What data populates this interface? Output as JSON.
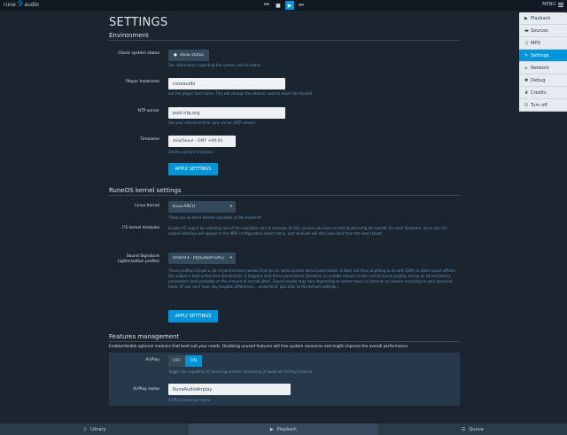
{
  "topbar": {
    "logo": {
      "word1": "rune",
      "word2": "audio",
      "mark": "9"
    },
    "menu_label": "MENU"
  },
  "menu": {
    "items": [
      {
        "label": "Playback",
        "icon": "play-icon"
      },
      {
        "label": "Sources",
        "icon": "folder-icon"
      },
      {
        "label": "MPD",
        "icon": "mpd-icon"
      },
      {
        "label": "Settings",
        "icon": "wrench-icon"
      },
      {
        "label": "Network",
        "icon": "network-icon"
      },
      {
        "label": "Debug",
        "icon": "bug-icon"
      },
      {
        "label": "Credits",
        "icon": "trophy-icon"
      },
      {
        "label": "Turn off",
        "icon": "power-icon"
      }
    ]
  },
  "page": {
    "title": "SETTINGS"
  },
  "environment": {
    "legend": "Environment",
    "check_status": {
      "label": "Check system status",
      "button": "show status",
      "help": "See information regarding the system and its status."
    },
    "hostname": {
      "label": "Player hostname",
      "value": "runeaudio",
      "help": "Set the player host name. This will change the address used to reach the RuneUI."
    },
    "ntp": {
      "label": "NTP server",
      "value": "pool.ntp.org",
      "help": "Set your reference time sync server (NTP server)."
    },
    "timezone": {
      "label": "Timezone",
      "value": "Asia/Seoul - GMT +09:00",
      "help": "Set the system timezone."
    },
    "apply": "APPLY SETTINGS"
  },
  "kernel": {
    "legend": "RuneOS kernel settings",
    "linux_kernel": {
      "label": "Linux Kernel",
      "value": "linux-ARCH",
      "help": "There are no other kernels available at the moment!"
    },
    "i2s": {
      "label": "I²S kernel modules",
      "help": "Enable I²S output by selecting one of the available sets of modules (In this version you have to edit /boot/config.txt specific for each hardware. Once set, the output interface will appear in the MPD configuration select menu, and modules will also auto-load from the next reboot."
    },
    "sound_sig": {
      "label1": "Sound Signature",
      "label2": "(optimization profile)",
      "value": "OrionV3 - (IQaudioPi-DAC)",
      "help": "These profiles include a set of performance tweaks that act on some system kernel parameters. It does not have anything to do with DSPs or other sound effects: the output is kept untouched (bit perfect). It happens that these parameters introduce an audible impact on the overall sound quality, acting on kernel latency parameters (and probably on the amount of overall jitter). Sound results may vary depending on where music is listened, so choose according to your personal taste. (If you can't hear any tangible differences... nevermind, just stick to the default settings.)"
    },
    "apply": "APPLY SETTINGS"
  },
  "features": {
    "legend": "Features management",
    "intro": "Enable/disable optional modules that best suit your needs. Disabling unused features will free system resources and might improve the overall performance.",
    "airplay": {
      "label": "AirPlay",
      "off": "OFF",
      "on": "ON",
      "help": "Toggle the capability of receiving wireless streaming of audio via AirPlay protocol"
    },
    "airplay_name": {
      "label": "AirPlay name",
      "value": "RuneAudioAirplay",
      "help": "AirPlay broadcast name"
    }
  },
  "bottombar": {
    "library": "Library",
    "playback": "Playback",
    "queue": "Queue"
  },
  "colors": {
    "accent": "#0095d8",
    "background": "#1a2530",
    "topbar": "#101921"
  }
}
